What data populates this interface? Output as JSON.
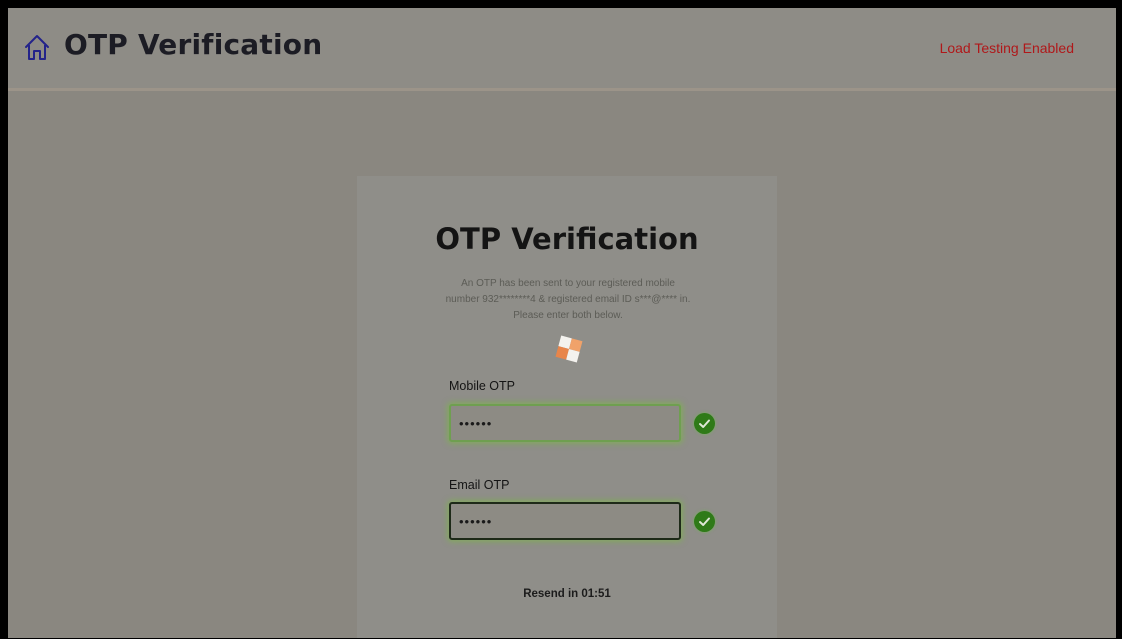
{
  "header": {
    "title": "OTP Verification",
    "home_icon": "home-icon",
    "status_text": "Load Testing Enabled",
    "status_color": "#b0181a"
  },
  "card": {
    "title": "OTP Verification",
    "description": "An OTP has been sent to your registered mobile number 932********4 & registered email ID s***@**** in. Please enter both below.",
    "mobile_label": "Mobile OTP",
    "mobile_value": "••••••",
    "email_label": "Email OTP",
    "email_value": "••••••",
    "verified_icon": "check-circle-icon",
    "resend_text": "Resend in 01:51"
  }
}
